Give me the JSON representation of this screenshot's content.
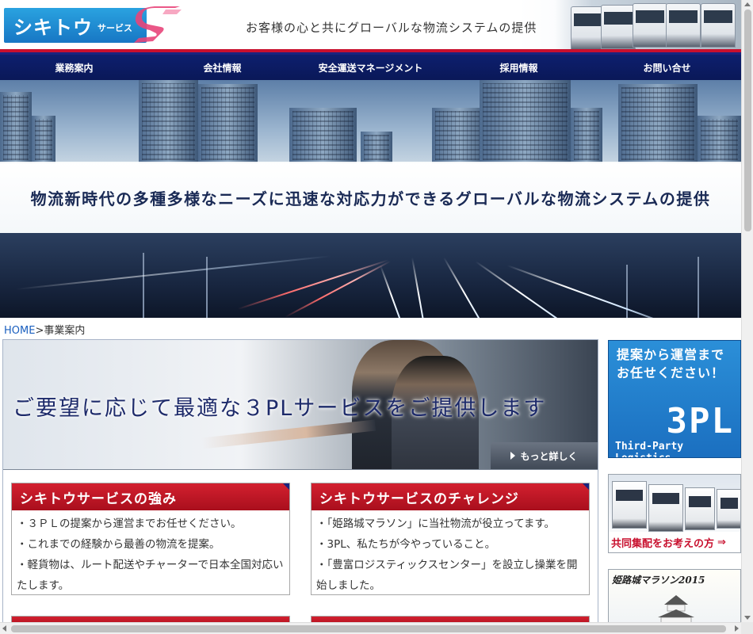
{
  "header": {
    "logo_main": "シキトウ",
    "logo_sub": "サービス",
    "tagline": "お客様の心と共にグローバルな物流システムの提供"
  },
  "nav": {
    "items": [
      "業務案内",
      "会社情報",
      "安全運送マネージメント",
      "採用情報",
      "お問い合せ"
    ]
  },
  "hero": {
    "text": "物流新時代の多種多様なニーズに迅速な対応力ができるグローバルな物流システムの提供"
  },
  "breadcrumb": {
    "home": "HOME",
    "separator": ">",
    "current": "事業案内"
  },
  "banner": {
    "text": "ご要望に応じて最適な３PLサービスをご提供します",
    "more_label": "もっと詳しく"
  },
  "boxes": [
    {
      "title": "シキトウサービスの強み",
      "items": [
        "・３ＰＬの提案から運営までお任せください。",
        "・これまでの経験から最善の物流を提案。",
        "・軽貨物は、ルート配送やチャーターで日本全国対応いたします。"
      ]
    },
    {
      "title": "シキトウサービスのチャレンジ",
      "items": [
        "・「姫路城マラソン」に当社物流が役立ってます。",
        "・3PL、私たちが今やっていること。",
        "・「豊富ロジスティックスセンター」を設立し操業を開始しました。"
      ]
    }
  ],
  "sidebar": {
    "promo_line1": "提案から運営まで",
    "promo_line2": "お任せください！",
    "promo_big": "3PL",
    "promo_small": "Third-Party Logistics",
    "truck_caption": "共同集配をお考えの方",
    "marathon_title": "姫路城マラソン2015"
  },
  "colors": {
    "nav_bg": "#0d1f6e",
    "box_head": "#c8102e",
    "logo_blue": "#1e88d6",
    "logo_pink": "#e8457a",
    "link": "#1a5fbf"
  }
}
